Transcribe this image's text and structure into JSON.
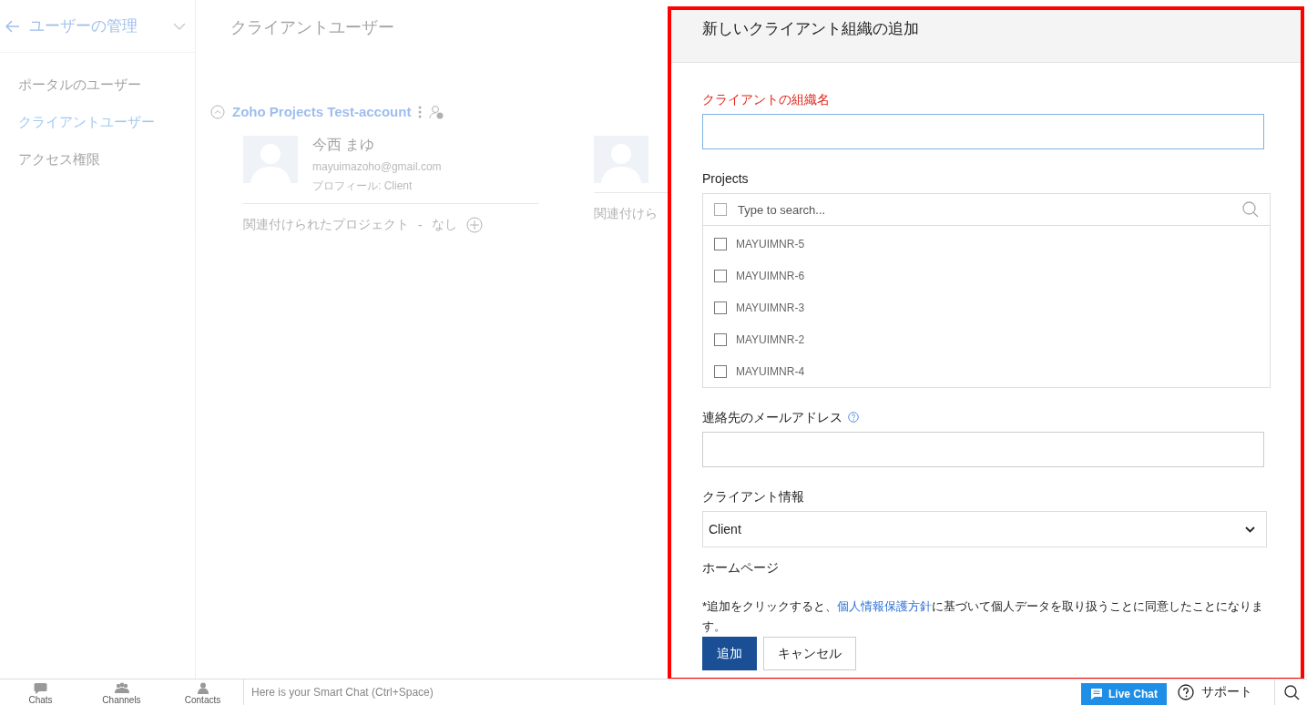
{
  "background": {
    "sidebar": {
      "title": "ユーザーの管理",
      "items": [
        {
          "label": "ポータルのユーザー",
          "selected": false
        },
        {
          "label": "クライアントユーザー",
          "selected": true
        },
        {
          "label": "アクセス権限",
          "selected": false
        }
      ]
    },
    "page_title": "クライアントユーザー",
    "organization": {
      "name": "Zoho Projects Test-account"
    },
    "users": [
      {
        "name": "今西 まゆ",
        "email": "mayuimazoho@gmail.com",
        "profile_label": "プロフィール:",
        "profile": "Client",
        "projects_label": "関連付けられたプロジェクト",
        "separator": "-",
        "projects": "なし"
      },
      {
        "projects_label": "関連付けら"
      }
    ]
  },
  "panel": {
    "title": "新しいクライアント組織の追加",
    "fields": [
      {
        "kind": "text",
        "label": "クライアントの組織名",
        "required": true,
        "focused": true
      },
      {
        "kind": "multiselect",
        "label": "Projects",
        "placeholder": "Type to search...",
        "all_checked": false,
        "options": [
          {
            "label": "MAYUIMNR-5",
            "checked": false
          },
          {
            "label": "MAYUIMNR-6",
            "checked": false
          },
          {
            "label": "MAYUIMNR-3",
            "checked": false
          },
          {
            "label": "MAYUIMNR-2",
            "checked": false
          },
          {
            "label": "MAYUIMNR-4",
            "checked": false
          }
        ]
      },
      {
        "kind": "text",
        "label": "連絡先のメールアドレス",
        "help": true,
        "focused": false
      },
      {
        "kind": "select",
        "label": "クライアント情報",
        "value": "Client"
      },
      {
        "kind": "heading",
        "label": "ホームページ"
      }
    ],
    "consent": {
      "before": "*追加をクリックすると、",
      "link": "個人情報保護方針",
      "after": "に基づいて個人データを取り扱うことに同意したことになります。"
    },
    "buttons": [
      {
        "label": "追加",
        "kind": "primary"
      },
      {
        "label": "キャンセル",
        "kind": "secondary"
      }
    ]
  },
  "footer": {
    "tabs": [
      {
        "label": "Chats",
        "kind": "chats"
      },
      {
        "label": "Channels",
        "kind": "channels"
      },
      {
        "label": "Contacts",
        "kind": "contacts"
      }
    ],
    "chat_placeholder": "Here is your Smart Chat (Ctrl+Space)",
    "live_chat": "Live Chat",
    "support": "サポート"
  }
}
